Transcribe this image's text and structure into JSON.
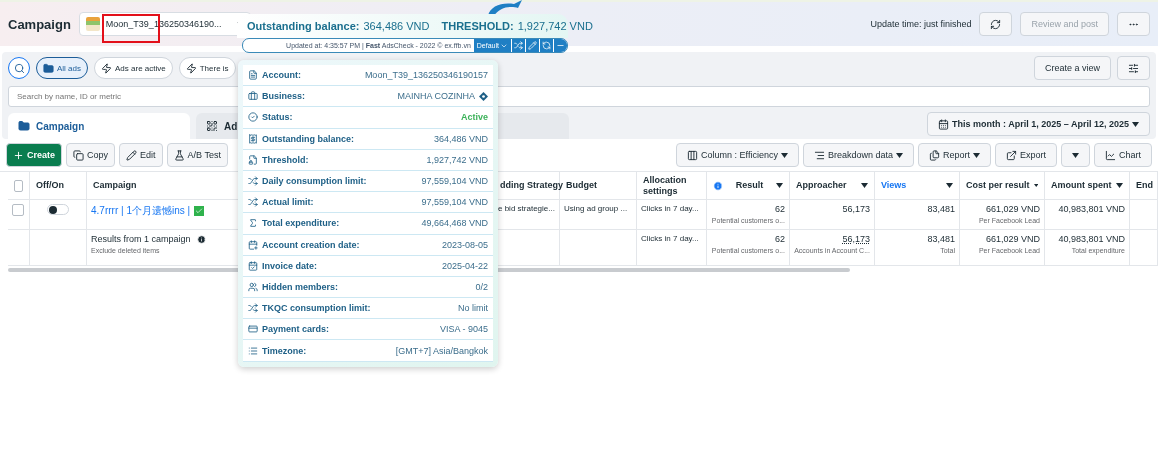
{
  "header": {
    "title": "Campaign",
    "account": "Moon_T39_136250346190...",
    "update_time": "Update time: just finished",
    "review_button": "Review and post",
    "review_disabled": true
  },
  "filters": {
    "chips": [
      {
        "label": "All ads",
        "selected": true
      },
      {
        "label": "Ads are active",
        "selected": false
      },
      {
        "label": "There is",
        "selected": false
      }
    ],
    "create_view": "Create a view",
    "search_placeholder": "Search by name, ID or metric"
  },
  "tabs": [
    {
      "label": "Campaign",
      "selected": true
    },
    {
      "label": "Ad",
      "selected": false
    }
  ],
  "date_range": "This month : April 1, 2025 – April 12, 2025",
  "toolbar": {
    "left": [
      {
        "label": "Create",
        "kind": "primary"
      },
      {
        "label": "Copy",
        "kind": "plain"
      },
      {
        "label": "Edit",
        "kind": "plain"
      },
      {
        "label": "A/B Test",
        "kind": "plain"
      }
    ],
    "right": [
      {
        "label": "Column : Efficiency",
        "caret": true
      },
      {
        "label": "Breakdown data",
        "caret": true
      },
      {
        "label": "Report",
        "caret": true
      },
      {
        "label": "Export",
        "caret": false
      },
      {
        "caret": true
      },
      {
        "label": "Chart",
        "caret": false
      }
    ]
  },
  "table": {
    "select_all_checked": false,
    "columns": [
      {
        "label": "Off/On",
        "sortable": false,
        "active": false,
        "info": false
      },
      {
        "label": "Campaign",
        "active": false,
        "info": false
      },
      {
        "label": "dding Strategy",
        "active": false,
        "info": false
      },
      {
        "label": "Budget",
        "sortable": false,
        "active": false,
        "info": false
      },
      {
        "label": "Allocation settings",
        "sortable": false,
        "active": false,
        "info": false
      },
      {
        "label": "Result",
        "sortable": true,
        "active": false,
        "info": true
      },
      {
        "label": "Approacher",
        "sortable": true,
        "active": false,
        "info": false
      },
      {
        "label": "Views",
        "sortable": true,
        "active": true,
        "info": false
      },
      {
        "label": "Cost per result",
        "sortable": true,
        "active": false,
        "info": false
      },
      {
        "label": "Amount spent",
        "sortable": true,
        "active": false,
        "info": false
      },
      {
        "label": "End",
        "active": false,
        "info": false
      }
    ],
    "rows": [
      {
        "checked": false,
        "on": false,
        "campaign": "4.7rrrr | 1个月遗憾ins |",
        "approved": true,
        "bidding": "e bid strategie...",
        "budget": "Using ad group ...",
        "allocation": "Clicks in 7 day...",
        "result": "62",
        "result_note": "Potential customers o...",
        "approacher": "56,173",
        "views": "83,481",
        "cost": "661,029 VND",
        "cost_note": "Per Facebook Lead",
        "amount": "40,983,801 VND"
      }
    ],
    "summary": {
      "title": "Results from 1 campaign",
      "note": "Exclude deleted items",
      "allocation": "Clicks in 7 day...",
      "result": "62",
      "result_note": "Potential customers o...",
      "approacher": "56,173",
      "approacher_note": "Accounts in Account C...",
      "views": "83,481",
      "views_note": "Total",
      "cost": "661,029 VND",
      "cost_note": "Per Facebook Lead",
      "amount": "40,983,801 VND",
      "amount_note": "Total expenditure"
    }
  },
  "extension": {
    "balance_label": "Outstanding balance:",
    "balance": "364,486 VND",
    "threshold_label": "THRESHOLD:",
    "threshold": "1,927,742 VND",
    "updated": "Updated at: 4:35:57 PM | **Fast** AdsCheck - 2022 © ex.ffb.vn",
    "preset": "Default",
    "details": [
      {
        "label": "Account:",
        "value": "Moon_T39_136250346190157",
        "kind": "text"
      },
      {
        "label": "Business:",
        "value": "MAINHA COZINHA",
        "kind": "badge"
      },
      {
        "label": "Status:",
        "value": "Active",
        "kind": "status"
      },
      {
        "label": "Outstanding balance:",
        "value": "364,486 VND",
        "kind": "text"
      },
      {
        "label": "Threshold:",
        "value": "1,927,742 VND",
        "kind": "text"
      },
      {
        "label": "Daily consumption limit:",
        "value": "97,559,104 VND",
        "kind": "text"
      },
      {
        "label": "Actual limit:",
        "value": "97,559,104 VND",
        "kind": "text"
      },
      {
        "label": "Total expenditure:",
        "value": "49,664,468 VND",
        "kind": "text"
      },
      {
        "label": "Account creation date:",
        "value": "2023-08-05",
        "kind": "text"
      },
      {
        "label": "Invoice date:",
        "value": "2025-04-22",
        "kind": "text"
      },
      {
        "label": "Hidden members:",
        "value": "0/2",
        "kind": "text"
      },
      {
        "label": "TKQC consumption limit:",
        "value": "No limit",
        "kind": "text"
      },
      {
        "label": "Payment cards:",
        "value": "VISA - 9045",
        "kind": "text"
      },
      {
        "label": "Timezone:",
        "value": "[GMT+7] Asia/Bangkok",
        "kind": "text"
      }
    ]
  }
}
